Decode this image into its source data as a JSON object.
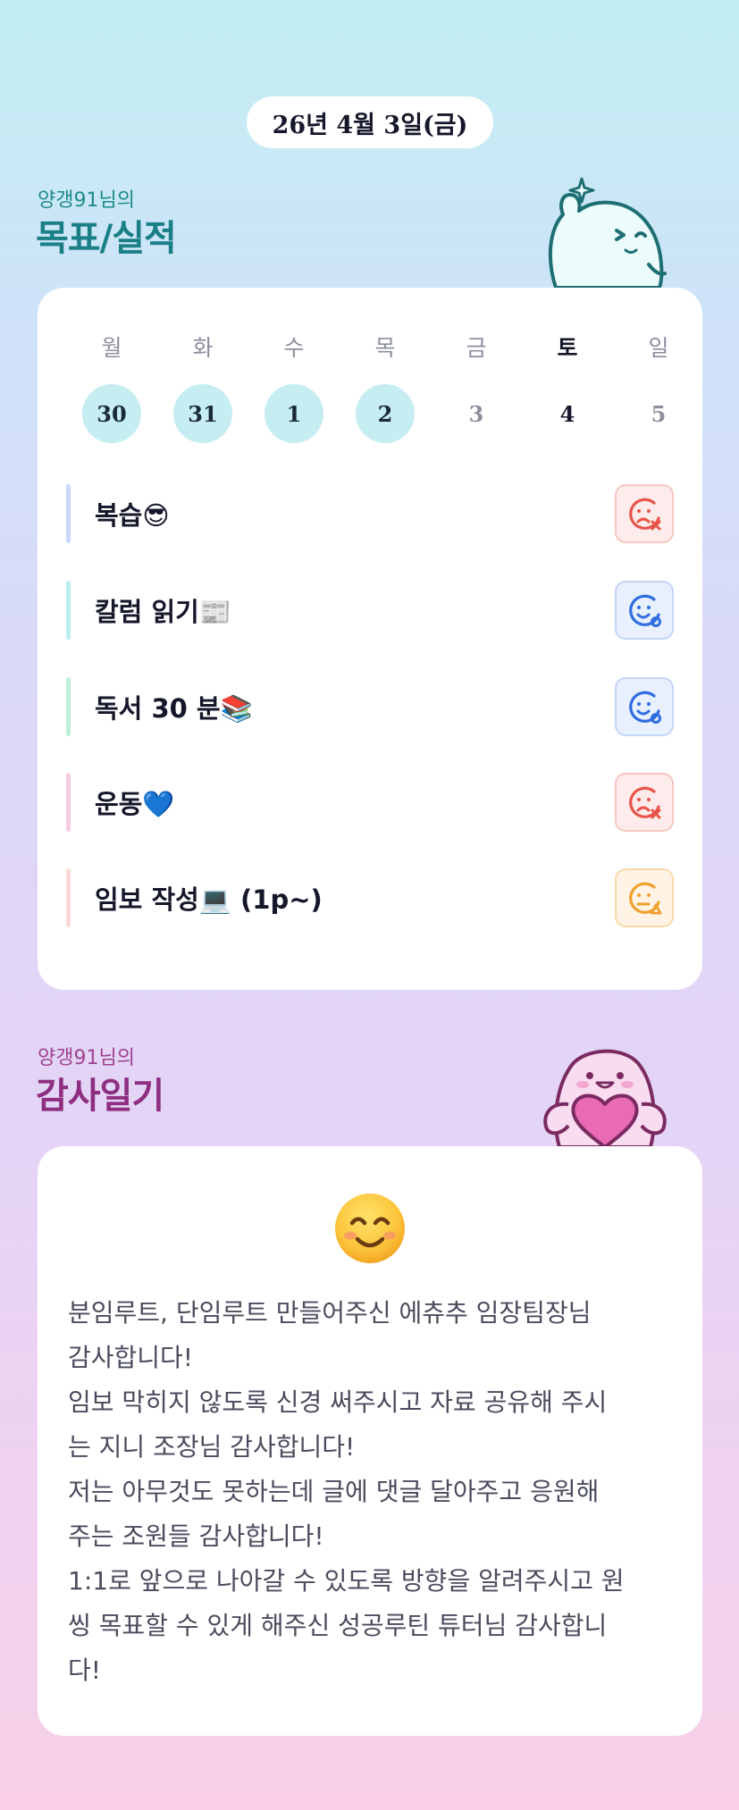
{
  "date": "26년 4월 3일(금)",
  "goal_section": {
    "owner": "양갱91님의",
    "title": "목표/실적"
  },
  "calendar": {
    "weekdays": [
      "월",
      "화",
      "수",
      "목",
      "금",
      "토",
      "일"
    ],
    "days": [
      "30",
      "31",
      "1",
      "2",
      "3",
      "4",
      "5"
    ],
    "done": [
      true,
      true,
      true,
      true,
      false,
      false,
      false
    ],
    "today_index": 5
  },
  "goals": [
    {
      "label": "복습😎",
      "status": "fail",
      "bar_color": "#c9d8fb"
    },
    {
      "label": "칼럼 읽기📰",
      "status": "success",
      "bar_color": "#bdeef1"
    },
    {
      "label": "독서 30 분📚",
      "status": "success",
      "bar_color": "#bff0da"
    },
    {
      "label": "운동💙",
      "status": "fail",
      "bar_color": "#f7cde3"
    },
    {
      "label": "임보 작성💻 (1p~)",
      "status": "partial",
      "bar_color": "#fbd9d9"
    }
  ],
  "status_colors": {
    "fail": "#e8544a",
    "success": "#2f6de0",
    "partial": "#f0a02c"
  },
  "gratitude_section": {
    "owner": "양갱91님의",
    "title": "감사일기"
  },
  "gratitude": {
    "mood_icon": "smiling-face-icon",
    "text": "분임루트, 단임루트 만들어주신 에츄추 임장팀장님\n감사합니다!\n임보 막히지 않도록 신경 써주시고 자료 공유해 주시\n는 지니 조장님 감사합니다!\n저는 아무것도 못하는데 글에 댓글 달아주고 응원해\n주는 조원들 감사합니다!\n1:1로 앞으로 나아갈 수 있도록 방향을 알려주시고 원\n씽 목표할 수 있게 해주신 성공루틴 튜터님 감사합니\n다!"
  }
}
